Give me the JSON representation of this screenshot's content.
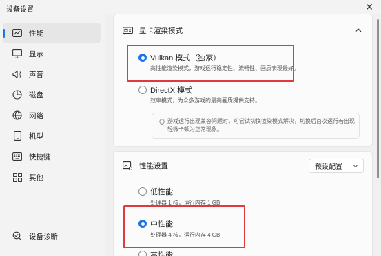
{
  "window": {
    "title": "设备设置",
    "close_glyph": "✕"
  },
  "sidebar": {
    "items": [
      {
        "label": "性能",
        "icon": "chart-icon"
      },
      {
        "label": "显示",
        "icon": "monitor-icon"
      },
      {
        "label": "声音",
        "icon": "speaker-icon"
      },
      {
        "label": "磁盘",
        "icon": "disk-icon"
      },
      {
        "label": "网络",
        "icon": "globe-icon"
      },
      {
        "label": "机型",
        "icon": "phone-icon"
      },
      {
        "label": "快捷键",
        "icon": "keyboard-icon"
      },
      {
        "label": "其他",
        "icon": "grid-icon"
      }
    ],
    "active_index": 0,
    "diagnostics": {
      "label": "设备诊断",
      "icon": "search-icon"
    }
  },
  "render_section": {
    "title": "显卡渲染模式",
    "options": [
      {
        "label": "Vulkan 模式（独家）",
        "desc": "高性能渲染模式，游戏运行稳定性、流畅性、画质表现最好。",
        "selected": true
      },
      {
        "label": "DirectX 模式",
        "desc": "效率模式，为众多游戏的最高画质提供支持。",
        "selected": false
      }
    ],
    "tip": "游戏运行出现兼容问题时，可尝试切换渲染模式解决，切换后首次运行若出现轻微卡顿为正常现象。"
  },
  "perf_section": {
    "title": "性能设置",
    "select_value": "预设配置",
    "options": [
      {
        "label": "低性能",
        "desc": "处理器 1 核，运行内存 1 GB",
        "selected": false
      },
      {
        "label": "中性能",
        "desc": "处理器 4 核，运行内存 4 GB",
        "selected": true
      },
      {
        "label": "高性能",
        "desc": "",
        "selected": false
      }
    ]
  },
  "colors": {
    "accent": "#1a73e8",
    "highlight": "#e0393e"
  }
}
